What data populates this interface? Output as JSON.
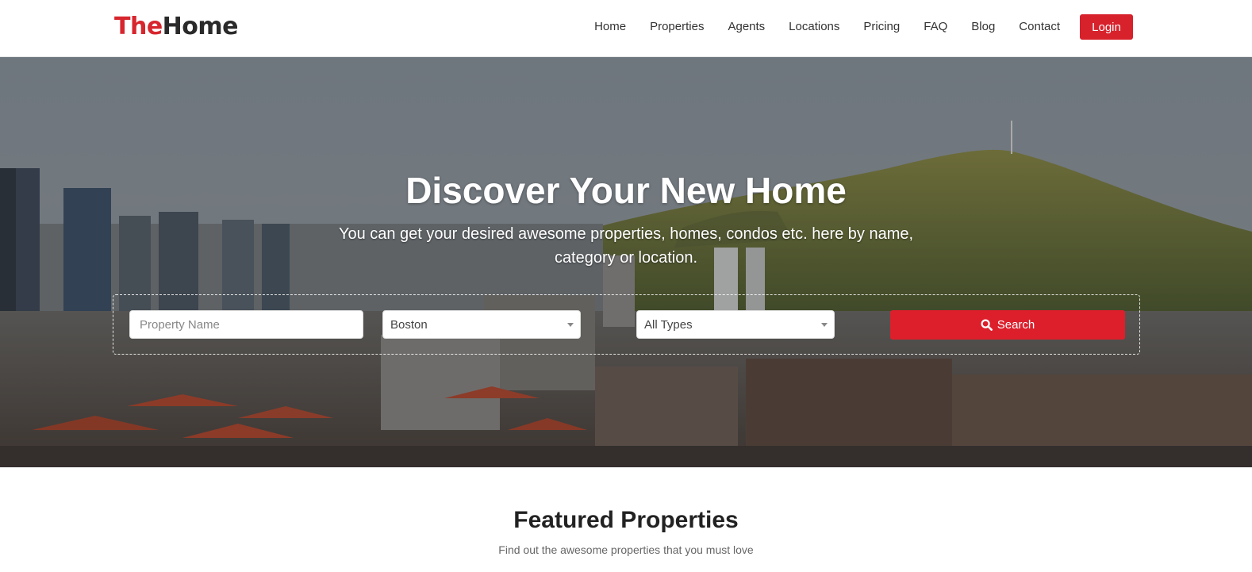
{
  "header": {
    "logo_the": "The",
    "logo_home": "Home",
    "nav": [
      "Home",
      "Properties",
      "Agents",
      "Locations",
      "Pricing",
      "FAQ",
      "Blog",
      "Contact"
    ],
    "login_label": "Login"
  },
  "hero": {
    "title": "Discover Your New Home",
    "subtitle": "You can get your desired awesome properties, homes, condos etc. here by name, category or location.",
    "search": {
      "name_placeholder": "Property Name",
      "city_selected": "Boston",
      "type_selected": "All Types",
      "button_label": "Search",
      "button_icon": "search-icon"
    }
  },
  "featured": {
    "title": "Featured Properties",
    "subtitle": "Find out the awesome properties that you must love"
  },
  "colors": {
    "brand_red": "#d7262e",
    "button_red": "#dc1f2b",
    "text_dark": "#222222"
  }
}
